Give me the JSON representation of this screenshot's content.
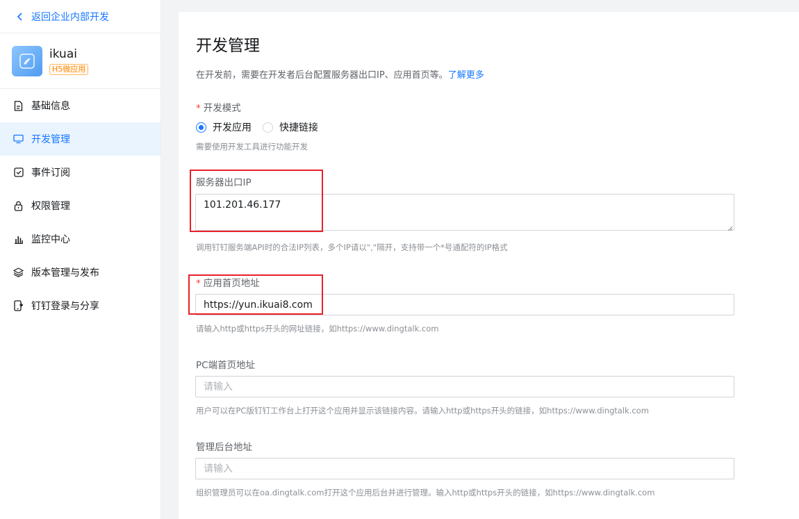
{
  "sidebar": {
    "back_label": "返回企业内部开发",
    "app": {
      "name": "ikuai",
      "badge": "H5微应用"
    },
    "items": [
      {
        "label": "基础信息",
        "icon": "document-icon"
      },
      {
        "label": "开发管理",
        "icon": "monitor-icon",
        "active": true
      },
      {
        "label": "事件订阅",
        "icon": "check-square-icon"
      },
      {
        "label": "权限管理",
        "icon": "lock-icon"
      },
      {
        "label": "监控中心",
        "icon": "bar-chart-icon"
      },
      {
        "label": "版本管理与发布",
        "icon": "layers-icon"
      },
      {
        "label": "钉钉登录与分享",
        "icon": "phone-share-icon"
      }
    ]
  },
  "main": {
    "title": "开发管理",
    "desc": "在开发前，需要在开发者后台配置服务器出口IP、应用首页等。",
    "desc_link": "了解更多",
    "dev_mode": {
      "label": "开发模式",
      "options": [
        "开发应用",
        "快捷链接"
      ],
      "selected": "开发应用",
      "hint": "需要使用开发工具进行功能开发"
    },
    "server_ip": {
      "label": "服务器出口IP",
      "value": "101.201.46.177",
      "hint": "调用钉钉服务端API时的合法IP列表，多个IP请以\",\"隔开，支持带一个*号通配符的IP格式"
    },
    "home_url": {
      "label": "应用首页地址",
      "value": "https://yun.ikuai8.com",
      "hint": "请输入http或https开头的网址链接，如https://www.dingtalk.com"
    },
    "pc_url": {
      "label": "PC端首页地址",
      "placeholder": "请输入",
      "hint": "用户可以在PC版钉钉工作台上打开这个应用并显示该链接内容。请输入http或https开头的链接，如https://www.dingtalk.com"
    },
    "admin_url": {
      "label": "管理后台地址",
      "placeholder": "请输入",
      "hint": "组织管理员可以在oa.dingtalk.com打开这个应用后台并进行管理。输入http或https开头的链接，如https://www.dingtalk.com"
    }
  },
  "colors": {
    "accent": "#1677ff",
    "highlight_box": "#e8202a",
    "required": "#ff3b30",
    "badge": "#ff8800"
  }
}
